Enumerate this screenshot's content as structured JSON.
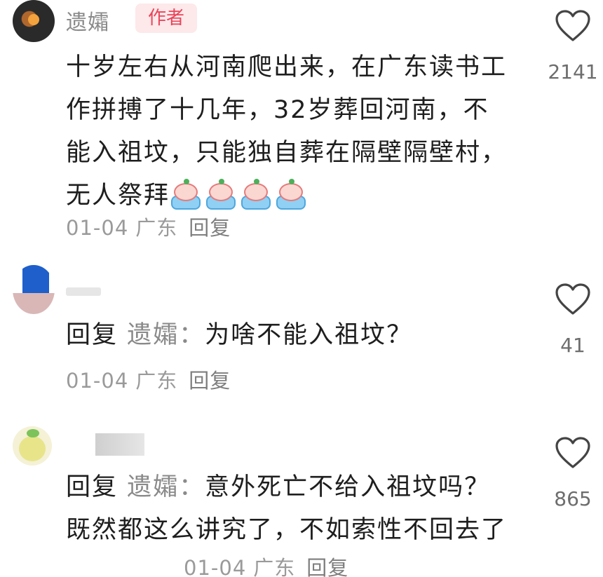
{
  "comments": [
    {
      "username": "遗孀",
      "badge": "作者",
      "text": "十岁左右从河南爬出来，在广东读书工作拼搏了十几年，32岁葬回河南，不能入祖坟，只能独自葬在隔壁隔壁村，无人祭拜",
      "date": "01-04",
      "location": "广东",
      "reply_label": "回复",
      "likes": "2141",
      "emoji_icons": [
        "crying-peach-icon",
        "crying-peach-icon",
        "crying-peach-icon",
        "crying-peach-icon"
      ]
    },
    {
      "reply_prefix": "回复",
      "reply_to": "遗孀：",
      "text": "为啥不能入祖坟？",
      "date": "01-04",
      "location": "广东",
      "reply_label": "回复",
      "likes": "41"
    },
    {
      "reply_prefix": "回复",
      "reply_to": "遗孀：",
      "text": "意外死亡不给入祖坟吗？既然都这么讲究了，不如索性不回去了",
      "date": "01-04",
      "location": "广东",
      "reply_label": "回复",
      "likes": "865"
    }
  ],
  "colors": {
    "badge_text": "#e8455a",
    "badge_bg": "#fde8ea",
    "meta": "#9a9a9a"
  }
}
